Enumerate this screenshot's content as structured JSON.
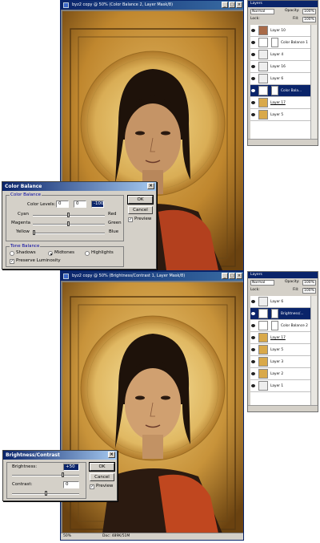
{
  "window1": {
    "title": "byz2 copy @ 50% (Color Balance 2, Layer Mask/8)"
  },
  "window2": {
    "title": "byz2 copy @ 50% (Brightness/Contrast 1, Layer Mask/8)",
    "zoom": "50%",
    "doc_info": "Doc: 489K/51M"
  },
  "layers1": {
    "tab": "Layers",
    "blend_mode": "Normal",
    "opacity_label": "Opacity:",
    "opacity_value": "100%",
    "lock_label": "Lock:",
    "fill_label": "Fill:",
    "fill_value": "100%",
    "items": [
      "Layer 10",
      "Color Balance 1",
      "Layer 4",
      "Layer 16",
      "Layer 6",
      "Color Bala...",
      "Layer 17",
      "Layer 5"
    ]
  },
  "layers2": {
    "tab": "Layers",
    "blend_mode": "Normal",
    "opacity_label": "Opacity:",
    "opacity_value": "100%",
    "lock_label": "Lock:",
    "fill_label": "Fill:",
    "fill_value": "100%",
    "items": [
      "Layer 6",
      "Brightness/...",
      "Color Balance 2",
      "Layer 17",
      "Layer 5",
      "Layer 3",
      "Layer 2",
      "Layer 1"
    ]
  },
  "color_balance": {
    "title": "Color Balance",
    "group_color": "Color Balance",
    "levels_label": "Color Levels:",
    "level1": "0",
    "level2": "0",
    "level3": "-100",
    "cyan": "Cyan",
    "red": "Red",
    "magenta": "Magenta",
    "green": "Green",
    "yellow": "Yellow",
    "blue": "Blue",
    "group_tone": "Tone Balance",
    "shadows": "Shadows",
    "midtones": "Midtones",
    "highlights": "Highlights",
    "preserve": "Preserve Luminosity",
    "ok": "OK",
    "cancel": "Cancel",
    "preview": "Preview"
  },
  "brightness_contrast": {
    "title": "Brightness/Contrast",
    "brightness_label": "Brightness:",
    "brightness_value": "+50",
    "contrast_label": "Contrast:",
    "contrast_value": "0",
    "ok": "OK",
    "cancel": "Cancel",
    "preview": "Preview"
  }
}
